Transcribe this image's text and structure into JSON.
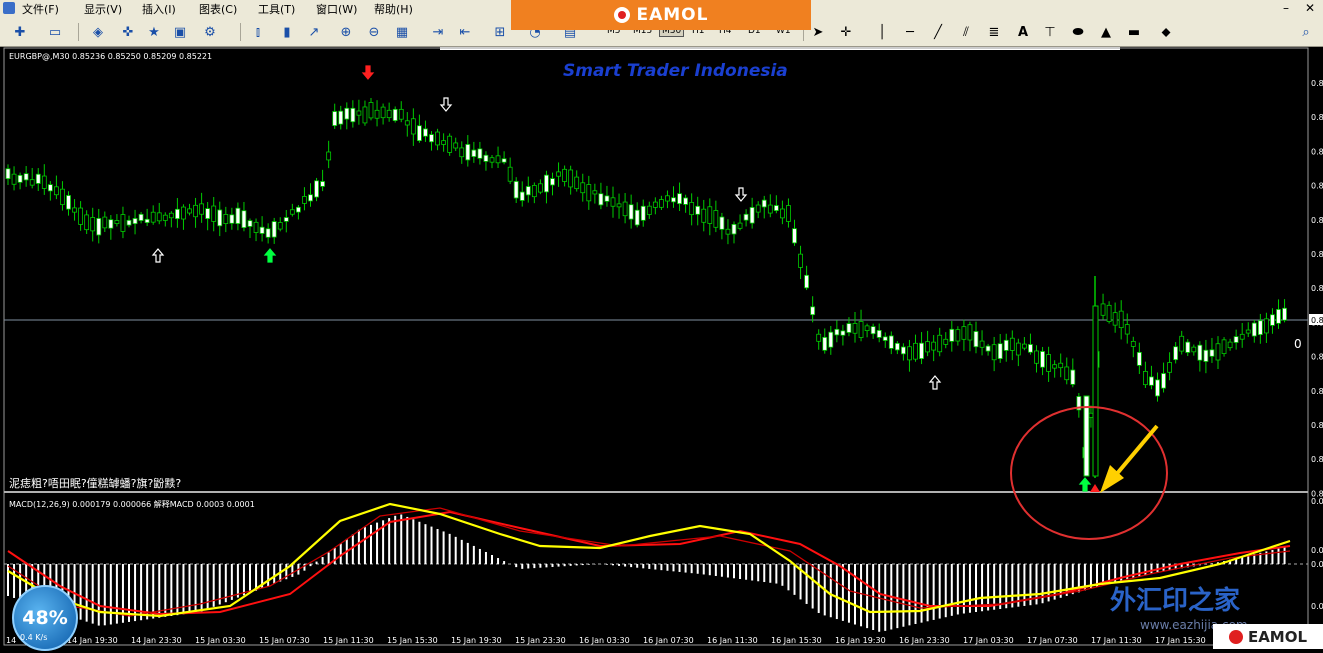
{
  "menu": {
    "items": [
      "文件(F)",
      "显示(V)",
      "插入(I)",
      "图表(C)",
      "工具(T)",
      "窗口(W)",
      "帮助(H)"
    ]
  },
  "brand": {
    "text": "EAMOL"
  },
  "toolbar": {
    "timeframes": [
      "M5",
      "M15",
      "M30",
      "H1",
      "H4",
      "D1",
      "W1"
    ],
    "active_timeframe": "M30",
    "draw_tool_letter": "A"
  },
  "chart": {
    "header": "EURGBP@,M30  0.85236 0.85250 0.85209 0.85221",
    "title": "Smart Trader Indonesia",
    "garbled_text": "泥痣粗?唔田眠?僮糕罅蟠?旗?鼢黩?",
    "price_labels_right": [
      "0.8",
      "0.8",
      "0.8",
      "0.8",
      "0.8",
      "0.8",
      "0.8",
      "0.8",
      "0.8",
      "0.8",
      "0.8",
      "0.8",
      "0.8"
    ],
    "current_price_label": "0.8",
    "right_edge_label": "0",
    "macd_header": "MACD(12,26,9) 0.000179 0.000066  解释MACD 0.0003 0.0001",
    "macd_axis_labels": [
      "0.0",
      "0.0",
      "0.0",
      "0.0"
    ],
    "time_labels": [
      "14 ",
      "14 Jan 19:30",
      "14 Jan 23:30",
      "15 Jan 03:30",
      "15 Jan 07:30",
      "15 Jan 11:30",
      "15 Jan 15:30",
      "15 Jan 19:30",
      "15 Jan 23:30",
      "16 Jan 03:30",
      "16 Jan 07:30",
      "16 Jan 11:30",
      "16 Jan 15:30",
      "16 Jan 19:30",
      "16 Jan 23:30",
      "17 Jan 03:30",
      "17 Jan 07:30",
      "17 Jan 11:30",
      "17 Jan 15:30",
      "17 Jan 19:30"
    ]
  },
  "speed_widget": {
    "percent": "48%",
    "rate": "0.4 K/s"
  },
  "watermark": {
    "cn": "外汇印之家",
    "url": "www.eazhijia.com"
  },
  "colors": {
    "candles": "#00cc00",
    "bull_fill": "#ffffff",
    "bear_fill": "#000000",
    "macd_signal": "#ffff00",
    "macd_main": "#ff0000",
    "circle": "#e03030",
    "arrow": "#ffd000"
  }
}
